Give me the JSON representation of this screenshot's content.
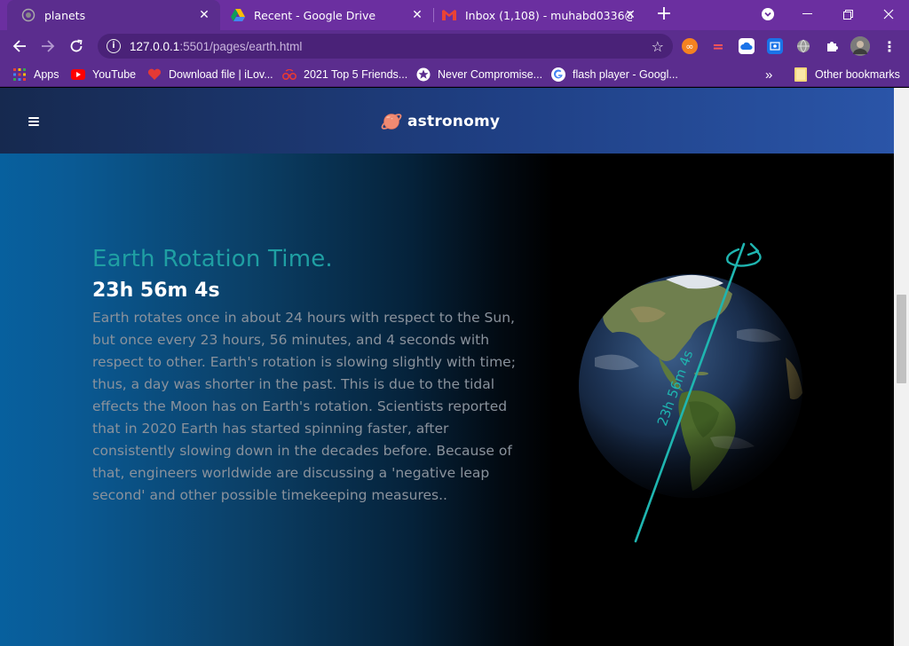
{
  "browser": {
    "tabs": [
      {
        "title": "planets",
        "icon": "globe-icon",
        "active": true
      },
      {
        "title": "Recent - Google Drive",
        "icon": "google-drive-icon",
        "active": false
      },
      {
        "title": "Inbox (1,108) - muhabd0336@gm",
        "icon": "gmail-icon",
        "active": false
      }
    ],
    "url_host": "127.0.0.1",
    "url_rest": ":5501/pages/earth.html",
    "bookmarks": [
      {
        "label": "Apps",
        "icon": "apps-grid-icon"
      },
      {
        "label": "YouTube",
        "icon": "youtube-icon"
      },
      {
        "label": "Download file | iLov...",
        "icon": "heart-icon"
      },
      {
        "label": "2021 Top 5 Friends...",
        "icon": "glasses-icon"
      },
      {
        "label": "Never Compromise...",
        "icon": "star-badge-icon"
      },
      {
        "label": "flash player - Googl...",
        "icon": "google-icon"
      }
    ],
    "other_bookmarks": "Other bookmarks",
    "overflow_label": "»"
  },
  "site": {
    "brand": "astronomy"
  },
  "section": {
    "heading": "Earth Rotation Time.",
    "subheading": "23h 56m 4s",
    "paragraph": "Earth rotates once in about 24 hours with respect to the Sun, but once every 23 hours, 56 minutes, and 4 seconds with respect to other. Earth's rotation is slowing slightly with time; thus, a day was shorter in the past. This is due to the tidal effects the Moon has on Earth's rotation. Scientists reported that in 2020 Earth has started spinning faster, after consistently slowing down in the decades before. Because of that, engineers worldwide are discussing a 'negative leap second' and other possible timekeeping measures..",
    "axis_label": "23h 56m 4s"
  },
  "colors": {
    "accent": "#1f9fa3",
    "browser_frame": "#6b2fa0"
  }
}
